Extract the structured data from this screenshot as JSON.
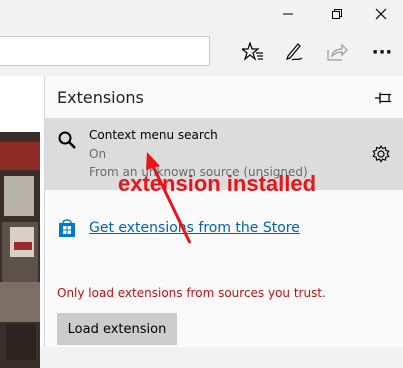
{
  "window": {
    "minimize_icon": "minimize-icon",
    "restore_icon": "restore-icon",
    "close_icon": "close-icon"
  },
  "toolbar": {
    "address_value": "",
    "favorites_icon": "favorites-star-icon",
    "notes_icon": "web-note-pen-icon",
    "share_icon": "share-icon",
    "more_label": "···"
  },
  "panel": {
    "title": "Extensions",
    "pin_icon": "pin-icon",
    "extension": {
      "name": "Context menu search",
      "status": "On",
      "source": "From an unknown source (unsigned)",
      "icon": "search-icon",
      "settings_icon": "gear-icon"
    },
    "store_link": "Get extensions from the Store",
    "store_icon": "store-bag-icon",
    "warning": "Only load extensions from sources you trust.",
    "load_button": "Load extension"
  },
  "annotation": {
    "text": "extension installed",
    "color": "#e8141a"
  },
  "colors": {
    "link": "#0063b1",
    "warning": "#c50f0f",
    "selected_item_bg": "#dcdcdc"
  }
}
